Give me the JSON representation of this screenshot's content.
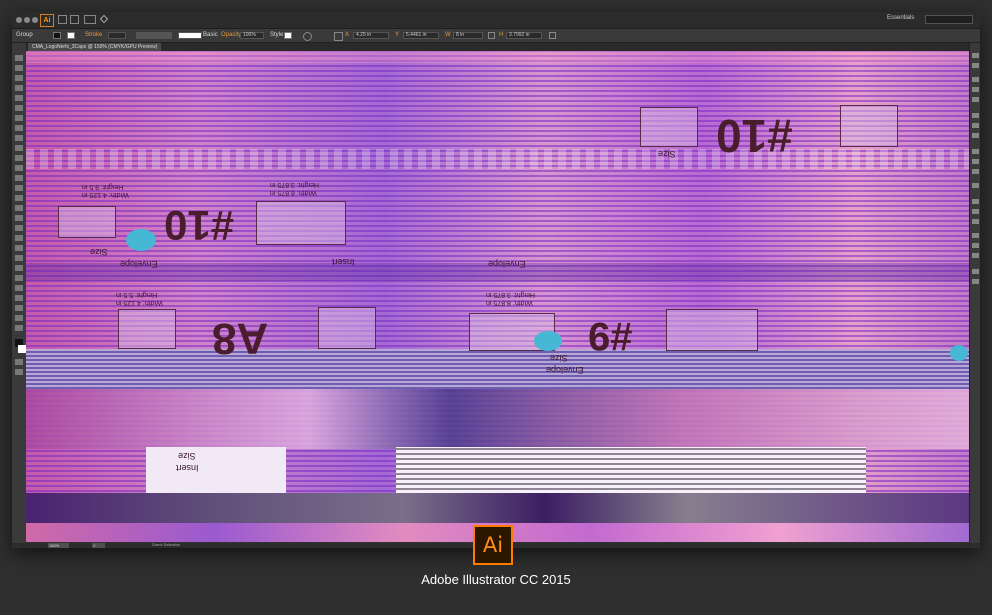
{
  "window": {
    "app_icon_label": "Ai",
    "workspace": "Essentials",
    "search_placeholder": "",
    "document_tab": "CMA_LogoNerfs_3Caps @ 150% (CMYK/GPU Preview)"
  },
  "control_bar": {
    "selection_label": "Group",
    "stroke_label": "Stroke",
    "brush_label": "Basic",
    "opacity_label": "Opacity",
    "opacity_value": "100%",
    "style_label": "Style",
    "x_label": "X",
    "x_value": "4.25 in",
    "y_label": "Y",
    "y_value": "5.4461 in",
    "w_label": "W",
    "w_value": "8 in",
    "h_label": "H",
    "h_value": "3.7992 in"
  },
  "status_bar": {
    "zoom": "150%",
    "page": "1",
    "tool_status": "Direct Selection"
  },
  "canvas_labels": {
    "big_1": "#10",
    "big_2": "#10",
    "big_3": "A8",
    "big_4": "#9",
    "size_1": "Size",
    "size_2": "Size",
    "size_3": "Size",
    "size_4": "Size",
    "insert_1": "Insert",
    "insert_2": "Insert",
    "envelope_1": "Envelope",
    "envelope_2": "Envelope",
    "envelope_3": "Envelope",
    "height_1": "Height: 9.5 in",
    "width_1": "Width: 4.125 in",
    "height_2": "Height: 3.875 in",
    "width_2": "Width: 8.875 in",
    "height_3": "Height: 5.5 in",
    "width_3": "Width: 4.125 in",
    "height_4": "Height: 3.875 in",
    "width_4": "Width: 8.875 in"
  },
  "brand": {
    "logo_text": "Ai",
    "caption": "Adobe Illustrator CC 2015",
    "accent": "#ff7c00"
  }
}
